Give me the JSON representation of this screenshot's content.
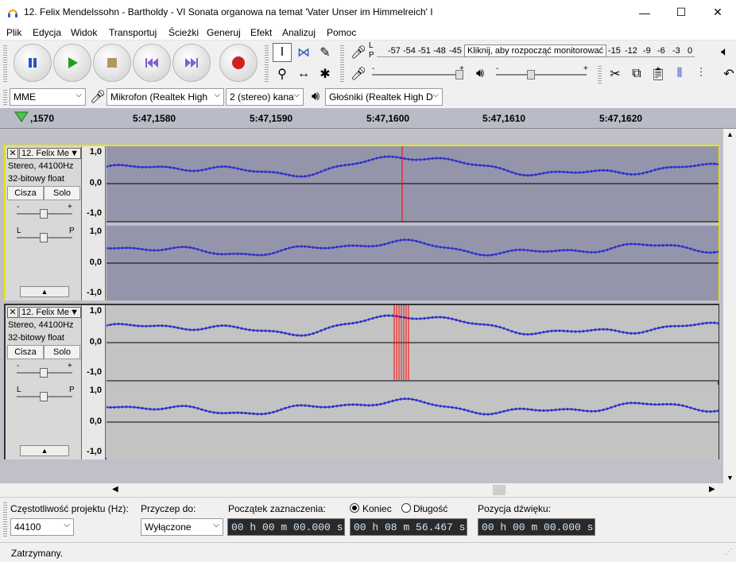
{
  "window": {
    "title": "12. Felix Mendelssohn - Bartholdy - VI Sonata organowa na temat 'Vater Unser im Himmelreich' I",
    "minimize": "—",
    "maximize": "☐",
    "close": "✕"
  },
  "menu": [
    "Plik",
    "Edycja",
    "Widok",
    "Transportuj",
    "Ścieżki",
    "Generuj",
    "Efekt",
    "Analizuj",
    "Pomoc"
  ],
  "meter": {
    "record_labels": {
      "l": "L",
      "p": "P"
    },
    "scale_left": [
      "-57",
      "-54",
      "-51",
      "-48",
      "-45"
    ],
    "monitor_tip": "Kliknij, aby rozpocząć monitorować",
    "scale_right": [
      "-15",
      "-12",
      "-9",
      "-6",
      "-3",
      "0"
    ],
    "slider_minus": "-",
    "slider_plus": "+"
  },
  "device": {
    "host": "MME",
    "mic": "Mikrofon (Realtek High",
    "channels": "2 (stereo) kana",
    "speakers": "Głośniki (Realtek High D"
  },
  "ruler": {
    "labels": [
      ",1570",
      "5:47,1580",
      "5:47,1590",
      "5:47,1600",
      "5:47,1610",
      "5:47,1620"
    ]
  },
  "tracks": [
    {
      "name": "12. Felix Me",
      "info1": "Stereo, 44100Hz",
      "info2": "32-bitowy float",
      "mute": "Cisza",
      "solo": "Solo",
      "gain_minus": "-",
      "gain_plus": "+",
      "pan_l": "L",
      "pan_p": "P",
      "scale": [
        "1,0",
        "0,0",
        "-1,0",
        "1,0",
        "0,0",
        "-1,0"
      ],
      "selected": true
    },
    {
      "name": "12. Felix Me",
      "info1": "Stereo, 44100Hz",
      "info2": "32-bitowy float",
      "mute": "Cisza",
      "solo": "Solo",
      "gain_minus": "-",
      "gain_plus": "+",
      "pan_l": "L",
      "pan_p": "P",
      "scale": [
        "1,0",
        "0,0",
        "-1,0",
        "1,0",
        "0,0",
        "-1,0"
      ],
      "selected": false
    }
  ],
  "bottom": {
    "rate_label": "Częstotliwość projektu (Hz):",
    "rate_value": "44100",
    "snap_label": "Przyczep do:",
    "snap_value": "Wyłączone",
    "sel_start_label": "Początek zaznaczenia:",
    "sel_start": "00 h 00 m 00.000 s",
    "end_label": "Koniec",
    "length_label": "Długość",
    "sel_end": "00 h 08 m 56.467 s",
    "pos_label": "Pozycja dźwięku:",
    "pos_value": "00 h 00 m 00.000 s"
  },
  "status": "Zatrzymany.",
  "colors": {
    "wave": "#3232c8",
    "cursor": "#ff0000",
    "track_selected_border": "#e6e600"
  }
}
